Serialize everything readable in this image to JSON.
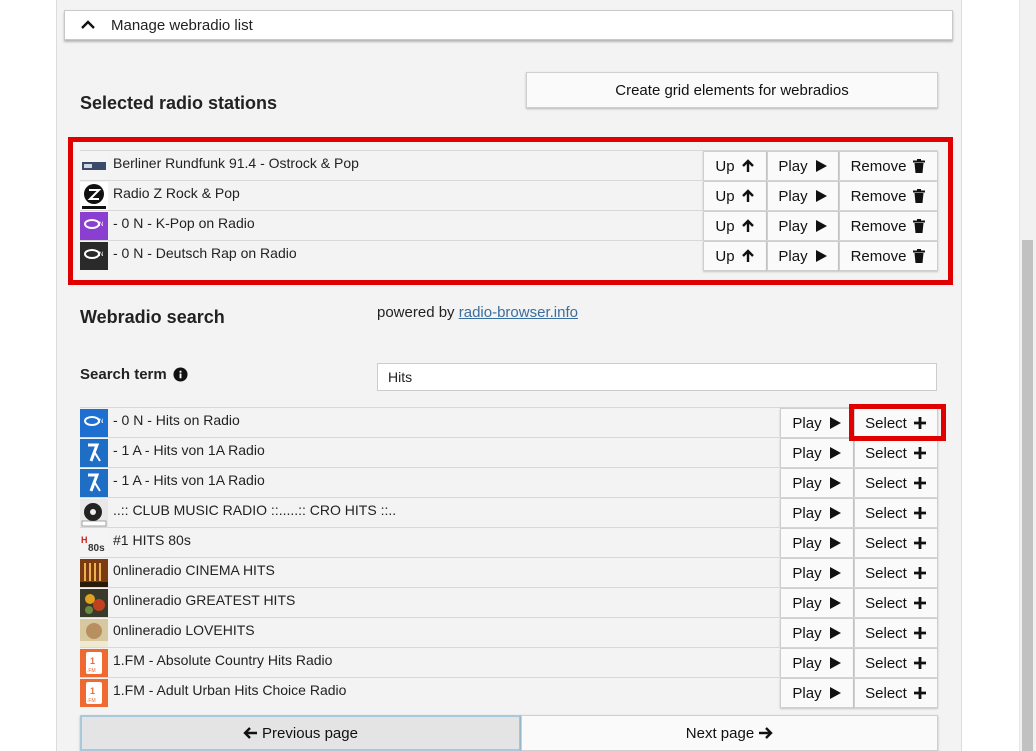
{
  "accordion": {
    "title": "Manage webradio list"
  },
  "selected": {
    "heading": "Selected radio stations",
    "create_button": "Create grid elements for webradios",
    "up_label": "Up",
    "play_label": "Play",
    "remove_label": "Remove",
    "stations": [
      {
        "name": "Berliner Rundfunk 91.4 - Ostrock & Pop",
        "logo": "berliner-rundfunk-logo"
      },
      {
        "name": "Radio Z Rock & Pop",
        "logo": "radio-z-logo"
      },
      {
        "name": "- 0 N - K-Pop on Radio",
        "logo": "0n-kpop-logo"
      },
      {
        "name": "- 0 N - Deutsch Rap on Radio",
        "logo": "0n-deutschrap-logo"
      }
    ]
  },
  "search": {
    "heading": "Webradio search",
    "powered_prefix": "powered by",
    "powered_link": "radio-browser.info",
    "term_label": "Search term",
    "term_value": "Hits",
    "play_label": "Play",
    "select_label": "Select",
    "results": [
      {
        "name": "- 0 N - Hits on Radio",
        "logo": "0n-hits-logo"
      },
      {
        "name": "- 1 A - Hits von 1A Radio",
        "logo": "1a-hits-logo"
      },
      {
        "name": "- 1 A - Hits von 1A Radio",
        "logo": "1a-hits-logo"
      },
      {
        "name": "..:: CLUB MUSIC RADIO ::.....:: CRO HITS ::..",
        "logo": "club-music-logo"
      },
      {
        "name": "#1 HITS 80s",
        "logo": "hits-80s-logo"
      },
      {
        "name": "0nlineradio CINEMA HITS",
        "logo": "cinema-hits-logo"
      },
      {
        "name": "0nlineradio GREATEST HITS",
        "logo": "greatest-hits-logo"
      },
      {
        "name": "0nlineradio LOVEHITS",
        "logo": "lovehits-logo"
      },
      {
        "name": "1.FM - Absolute Country Hits Radio",
        "logo": "1fm-logo"
      },
      {
        "name": "1.FM - Adult Urban Hits Choice Radio",
        "logo": "1fm-logo"
      }
    ]
  },
  "pagination": {
    "prev_label": "Previous page",
    "next_label": "Next page"
  },
  "colors": {
    "highlight": "#e00000",
    "link": "#3a6e9e",
    "panel": "#f3f3f3"
  }
}
